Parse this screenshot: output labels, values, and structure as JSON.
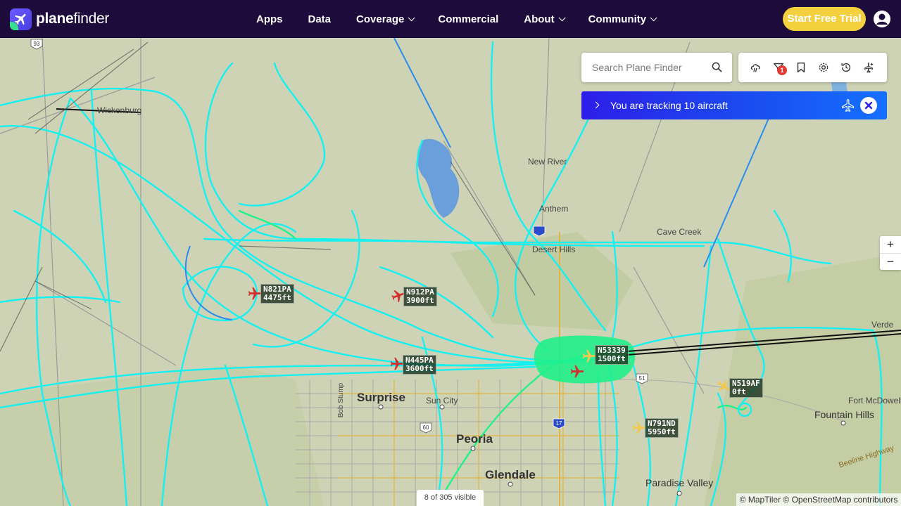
{
  "brand": {
    "prefix": "plane",
    "suffix": "finder"
  },
  "nav": {
    "items": [
      {
        "label": "Apps",
        "dropdown": false
      },
      {
        "label": "Data",
        "dropdown": false
      },
      {
        "label": "Coverage",
        "dropdown": true
      },
      {
        "label": "Commercial",
        "dropdown": false
      },
      {
        "label": "About",
        "dropdown": true
      },
      {
        "label": "Community",
        "dropdown": true
      }
    ],
    "trial_label": "Start Free Trial"
  },
  "search": {
    "placeholder": "Search Plane Finder"
  },
  "toolbar": {
    "buttons": [
      "weather-icon",
      "filter-icon",
      "bookmark-icon",
      "settings-icon",
      "history-icon",
      "airport-icon"
    ],
    "filter_badge": "1"
  },
  "tracking": {
    "text": "You are tracking 10 aircraft"
  },
  "zoom": {
    "in": "+",
    "out": "−"
  },
  "places": [
    {
      "name": "Wickenburg",
      "class": ""
    },
    {
      "name": "New River",
      "class": ""
    },
    {
      "name": "Anthem",
      "class": ""
    },
    {
      "name": "Cave Creek",
      "class": ""
    },
    {
      "name": "Desert Hills",
      "class": ""
    },
    {
      "name": "Surprise",
      "class": "big"
    },
    {
      "name": "Sun City",
      "class": ""
    },
    {
      "name": "Peoria",
      "class": "big"
    },
    {
      "name": "Glendale",
      "class": "big"
    },
    {
      "name": "Fountain Hills",
      "class": "mid"
    },
    {
      "name": "Fort McDowell",
      "class": ""
    },
    {
      "name": "Paradise Valley",
      "class": "mid"
    },
    {
      "name": "Verde",
      "class": ""
    },
    {
      "name": "Beeline Highway",
      "class": ""
    },
    {
      "name": "Bob Stump",
      "class": ""
    }
  ],
  "aircraft": [
    {
      "reg": "N821PA",
      "alt": "4475ft",
      "color": "#d32f2f"
    },
    {
      "reg": "N912PA",
      "alt": "3900ft",
      "color": "#d32f2f"
    },
    {
      "reg": "N445PA",
      "alt": "3600ft",
      "color": "#d32f2f"
    },
    {
      "reg": "N53339",
      "alt": "1500ft",
      "color": "#f2c94c"
    },
    {
      "reg": "N519AF",
      "alt": "0ft",
      "color": "#f2c94c"
    },
    {
      "reg": "N791ND",
      "alt": "5950ft",
      "color": "#f2c94c"
    }
  ],
  "route_shields": [
    "93",
    "60",
    "17",
    "51"
  ],
  "status": {
    "visible": "8 of 305 visible"
  },
  "attribution": "© MapTiler © OpenStreetMap contributors",
  "colors": {
    "nav_bg": "#1d0b3c",
    "trial_btn": "#f4d03f",
    "track": "#16f0f0",
    "track_alt": "#22f28a",
    "tracking_bar": "#2d1ee8"
  }
}
